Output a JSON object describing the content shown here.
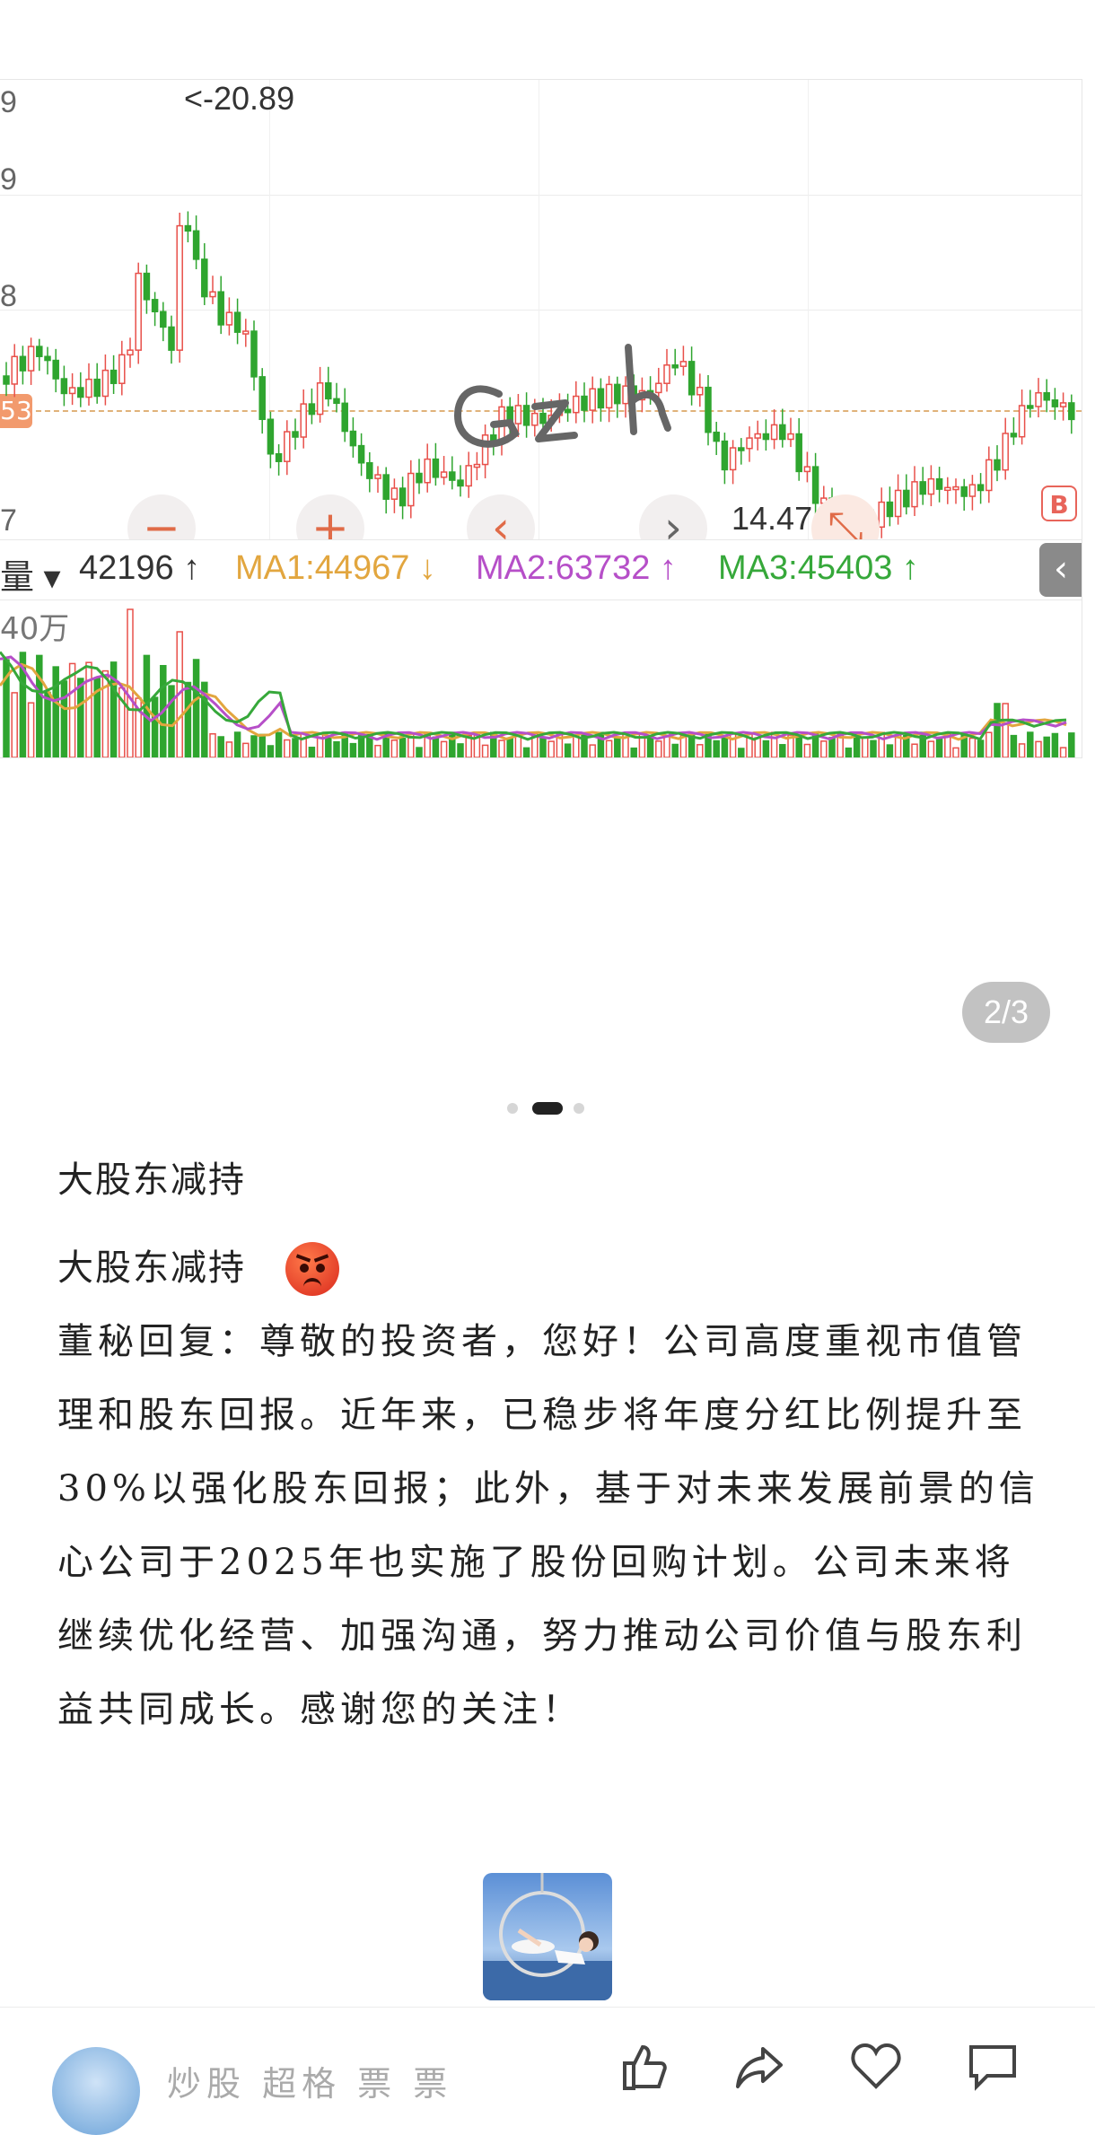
{
  "chart": {
    "y_labels": [
      "9",
      "9",
      "8",
      "7"
    ],
    "current_price_badge": "53",
    "high_annotation": "<-20.89",
    "low_annotation": "14.47->",
    "handwriting": "Gzh",
    "buy_marker": "B",
    "volume_selector": "量 ▾",
    "volume_value": "42196 ↑",
    "ma1": "MA1:44967 ↓",
    "ma2": "MA2:63732 ↑",
    "ma3": "MA3:45403 ↑",
    "volume_axis_label": "40万",
    "collapse_icon": "chevron-left-icon",
    "colors": {
      "up": "#e8504a",
      "down": "#2fa52f",
      "ma1": "#e2a63f",
      "ma2": "#b64fc8",
      "ma3": "#36a83a"
    }
  },
  "carousel": {
    "page_counter": "2/3",
    "dot_count": 3,
    "active_index": 1
  },
  "post": {
    "title": "大股东减持",
    "first_line": "大股东减持",
    "emoji": "angry-face-icon",
    "body": "董秘回复：尊敬的投资者，您好！公司高度重视市值管理和股东回报。近年来，已稳步将年度分红比例提升至30%以强化股东回报；此外，基于对未来发展前景的信心公司于2025年也实施了股份回购计划。公司未来将继续优化经营、加强沟通，努力推动公司价值与股东利益共同成长。感谢您的关注！"
  },
  "bottom_bar": {
    "author": "炒股 超格 票 票",
    "actions": [
      "like-icon",
      "share-icon",
      "favorite-icon",
      "comment-icon"
    ]
  },
  "chart_data": {
    "type": "candlestick",
    "high_label": "20.89",
    "low_label": "14.47",
    "series": [
      {
        "name": "MA1",
        "value": 44967
      },
      {
        "name": "MA2",
        "value": 63732
      },
      {
        "name": "MA3",
        "value": 45403
      }
    ],
    "volume": 42196
  }
}
